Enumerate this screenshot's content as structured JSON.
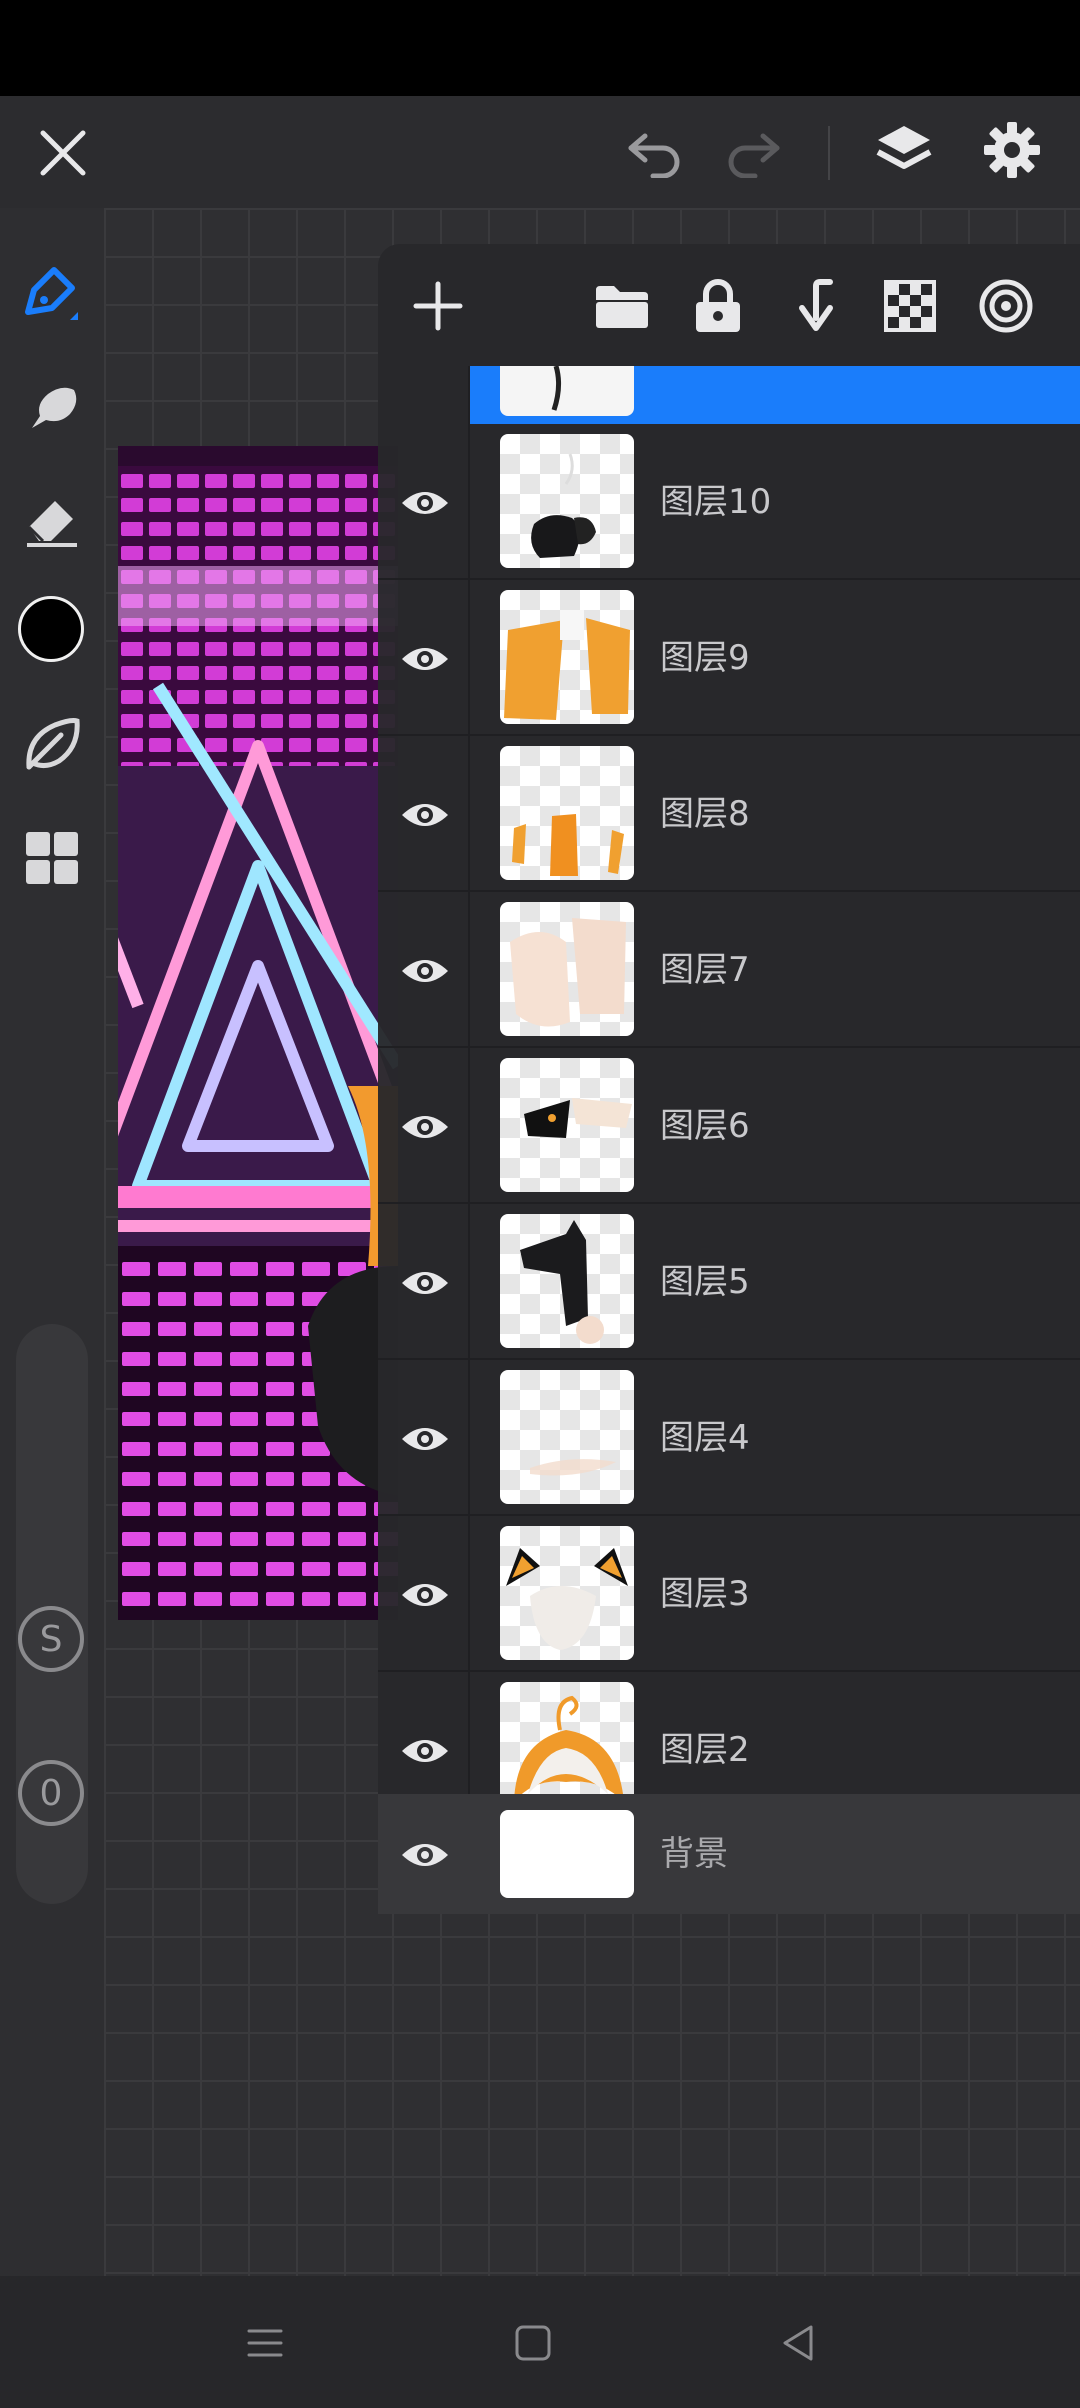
{
  "app": {
    "accent_color": "#1a7dfb",
    "close_icon": "close-icon",
    "undo_icon": "undo-icon",
    "redo_icon": "redo-icon",
    "layers_icon": "layers-icon",
    "settings_icon": "gear-icon"
  },
  "left_toolbar": {
    "tools": [
      "pen-tool-icon",
      "smudge-tool-icon",
      "eraser-tool-icon",
      "color-swatch",
      "leaf-brush-icon",
      "grid-tools-icon"
    ],
    "current_color": "#000000",
    "size_label": "S",
    "opacity_label": "0"
  },
  "layers_panel": {
    "toolbar": [
      "add-layer-icon",
      "folder-icon",
      "lock-icon",
      "merge-down-icon",
      "checkerboard-icon",
      "target-icon"
    ],
    "layers": [
      {
        "name": "图层10"
      },
      {
        "name": "图层9"
      },
      {
        "name": "图层8"
      },
      {
        "name": "图层7"
      },
      {
        "name": "图层6"
      },
      {
        "name": "图层5"
      },
      {
        "name": "图层4"
      },
      {
        "name": "图层3"
      },
      {
        "name": "图层2"
      }
    ],
    "background_layer": {
      "name": "背景"
    }
  },
  "nav_bar": [
    "menu-icon",
    "home-icon",
    "back-icon"
  ]
}
